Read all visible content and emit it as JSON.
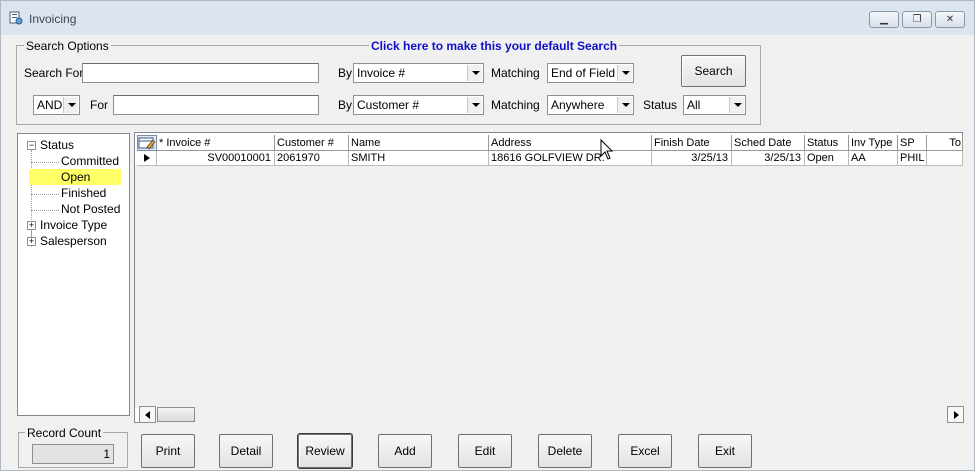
{
  "window": {
    "title": "Invoicing"
  },
  "search": {
    "legend": "Search Options",
    "default_link": "Click here to make this your default Search",
    "row1": {
      "label": "Search For",
      "value": "",
      "by_label": "By",
      "by_value": "Invoice #",
      "matching_label": "Matching",
      "matching_value": "End of Field"
    },
    "row2": {
      "logic": "AND",
      "label": "For",
      "value": "",
      "by_label": "By",
      "by_value": "Customer #",
      "matching_label": "Matching",
      "matching_value": "Anywhere",
      "status_label": "Status",
      "status_value": "All"
    },
    "button": "Search"
  },
  "tree": {
    "nodes": [
      {
        "label": "Status",
        "expander": "−"
      },
      {
        "label": "Committed"
      },
      {
        "label": "Open"
      },
      {
        "label": "Finished"
      },
      {
        "label": "Not Posted"
      },
      {
        "label": "Invoice Type",
        "expander": "+"
      },
      {
        "label": "Salesperson",
        "expander": "+"
      }
    ]
  },
  "grid": {
    "columns": [
      "* Invoice #",
      "Customer #",
      "Name",
      "Address",
      "Finish Date",
      "Sched Date",
      "Status",
      "Inv Type",
      "SP",
      "To"
    ],
    "rows": [
      [
        "SV00010001",
        "2061970",
        "SMITH",
        "18616 GOLFVIEW DR.",
        "3/25/13",
        "3/25/13",
        "Open",
        "AA",
        "PHIL",
        ""
      ]
    ]
  },
  "record_count": {
    "label": "Record Count",
    "value": "1"
  },
  "buttons": [
    "Print",
    "Detail",
    "Review",
    "Add",
    "Edit",
    "Delete",
    "Excel",
    "Exit"
  ],
  "colors": {
    "highlight": "#ffff66",
    "link": "#1010c8"
  }
}
